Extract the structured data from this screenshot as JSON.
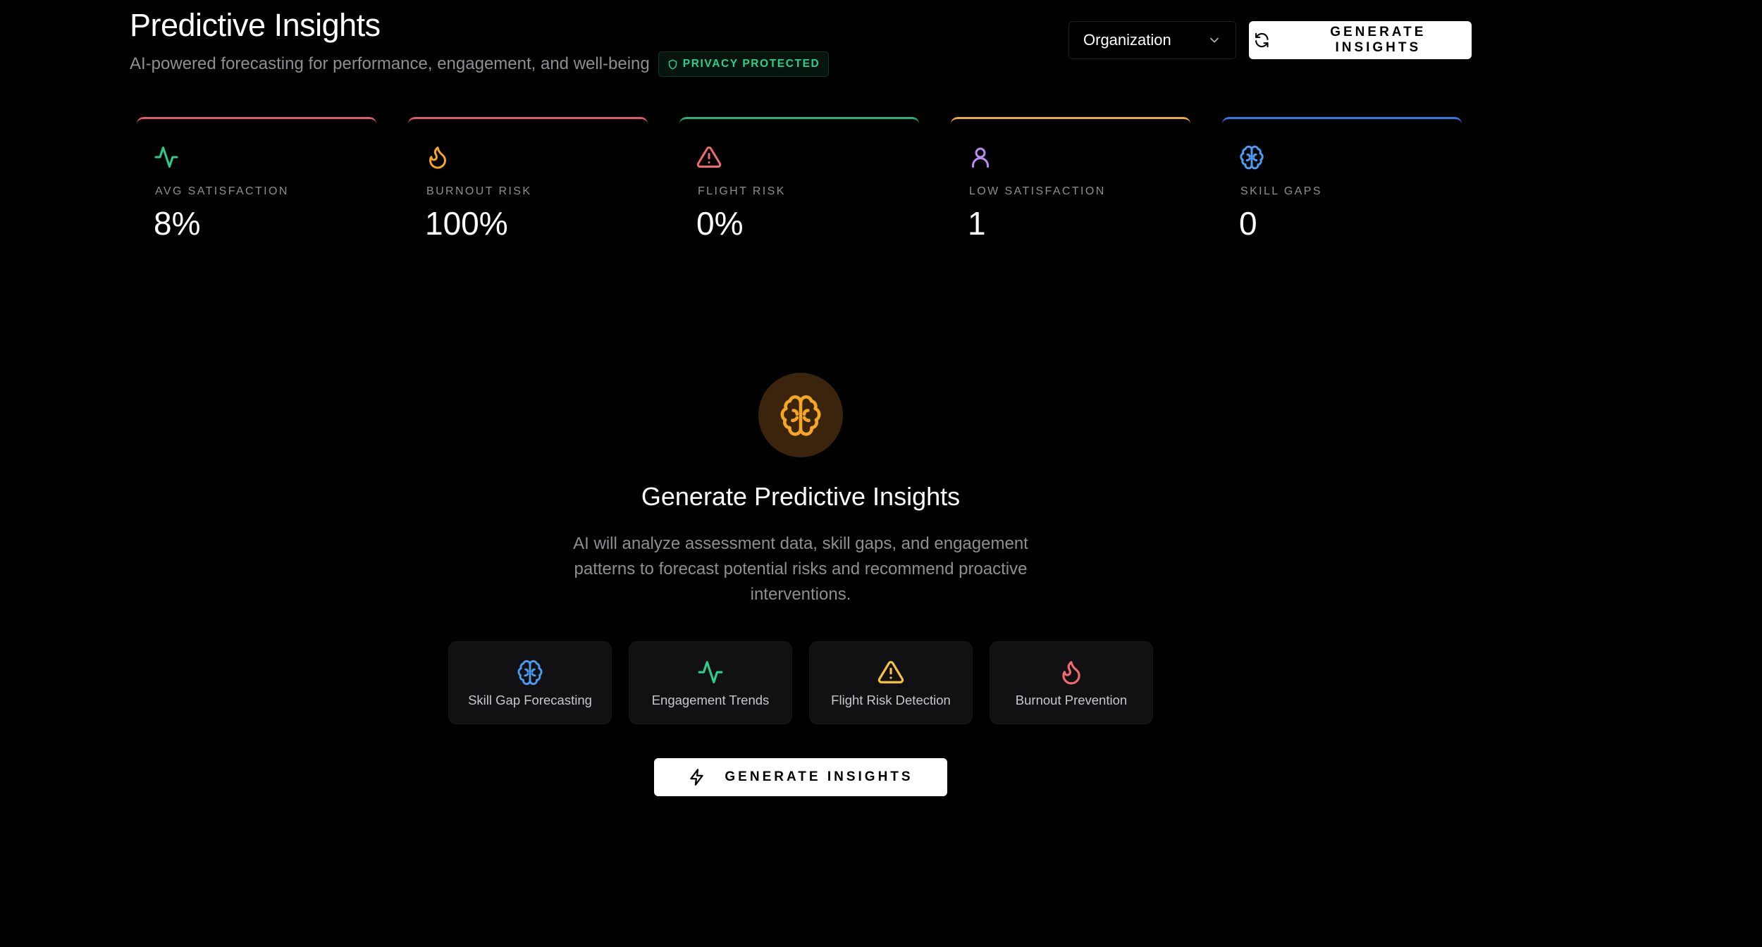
{
  "header": {
    "title": "Predictive Insights",
    "subtitle": "AI-powered forecasting for performance, engagement, and well-being",
    "privacy_badge": "PRIVACY PROTECTED",
    "scope_select": {
      "value": "Organization",
      "icon": "chevron-down-icon"
    },
    "generate_button": {
      "label": "GENERATE INSIGHTS",
      "icon": "refresh-icon"
    }
  },
  "stats": [
    {
      "label": "AVG SATISFACTION",
      "value": "8%",
      "icon": "activity-icon",
      "color": "#2ecc8a",
      "top_color": "#e05a63"
    },
    {
      "label": "BURNOUT RISK",
      "value": "100%",
      "icon": "flame-icon",
      "color": "#f5a623",
      "top_color": "#e05a63"
    },
    {
      "label": "FLIGHT RISK",
      "value": "0%",
      "icon": "alert-triangle-icon",
      "color": "#f06a73",
      "top_color": "#24b37c"
    },
    {
      "label": "LOW SATISFACTION",
      "value": "1",
      "icon": "user-icon",
      "color": "#b98cf0",
      "top_color": "#f0a73a"
    },
    {
      "label": "SKILL GAPS",
      "value": "0",
      "icon": "brain-icon",
      "color": "#4a9cf5",
      "top_color": "#2f7de0"
    }
  ],
  "empty_state": {
    "icon": "brain-icon",
    "icon_color": "#f5a623",
    "title": "Generate Predictive Insights",
    "description": "AI will analyze assessment data, skill gaps, and engagement patterns to forecast potential risks and recommend proactive interventions.",
    "features": [
      {
        "label": "Skill Gap Forecasting",
        "icon": "brain-icon",
        "color": "#4a9cf5"
      },
      {
        "label": "Engagement Trends",
        "icon": "activity-icon",
        "color": "#2ecc8a"
      },
      {
        "label": "Flight Risk Detection",
        "icon": "alert-triangle-icon",
        "color": "#f5c242"
      },
      {
        "label": "Burnout Prevention",
        "icon": "flame-icon",
        "color": "#f06a73"
      }
    ],
    "generate_button": {
      "label": "GENERATE INSIGHTS",
      "icon": "zap-icon"
    }
  }
}
